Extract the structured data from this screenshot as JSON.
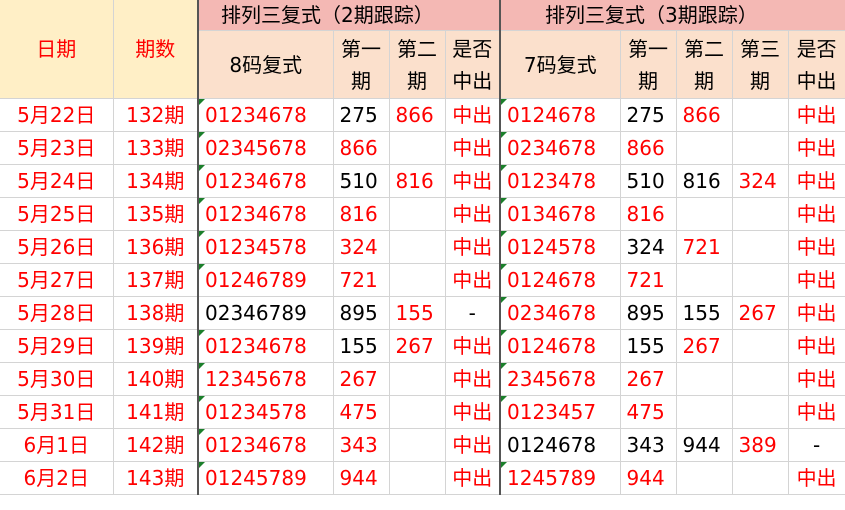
{
  "header": {
    "date": "日期",
    "period": "期数",
    "group2": "排列三复式（2期跟踪）",
    "group3": "排列三复式（3期跟踪）",
    "code8": "8码复式",
    "code7": "7码复式",
    "first_a": "第一",
    "first_b": "期",
    "second_a": "第二",
    "second_b": "期",
    "third_a": "第三",
    "third_b": "期",
    "hit_a": "是否",
    "hit_b": "中出"
  },
  "rows": [
    {
      "date": "5月22日",
      "period": "132期",
      "c8": "01234678",
      "a1": "275",
      "a2": "866",
      "ah": "中出",
      "c7": "0124678",
      "b1": "275",
      "b2": "866",
      "b3": "",
      "bh": "中出"
    },
    {
      "date": "5月23日",
      "period": "133期",
      "c8": "02345678",
      "a1": "866",
      "a2": "",
      "ah": "中出",
      "c7": "0234678",
      "b1": "866",
      "b2": "",
      "b3": "",
      "bh": "中出"
    },
    {
      "date": "5月24日",
      "period": "134期",
      "c8": "01234678",
      "a1": "510",
      "a2": "816",
      "ah": "中出",
      "c7": "0123478",
      "b1": "510",
      "b2": "816",
      "b3": "324",
      "bh": "中出"
    },
    {
      "date": "5月25日",
      "period": "135期",
      "c8": "01234678",
      "a1": "816",
      "a2": "",
      "ah": "中出",
      "c7": "0134678",
      "b1": "816",
      "b2": "",
      "b3": "",
      "bh": "中出"
    },
    {
      "date": "5月26日",
      "period": "136期",
      "c8": "01234578",
      "a1": "324",
      "a2": "",
      "ah": "中出",
      "c7": "0124578",
      "b1": "324",
      "b2": "721",
      "b3": "",
      "bh": "中出"
    },
    {
      "date": "5月27日",
      "period": "137期",
      "c8": "01246789",
      "a1": "721",
      "a2": "",
      "ah": "中出",
      "c7": "0124678",
      "b1": "721",
      "b2": "",
      "b3": "",
      "bh": "中出"
    },
    {
      "date": "5月28日",
      "period": "138期",
      "c8": "02346789",
      "a1": "895",
      "a2": "155",
      "ah": "-",
      "c7": "0234678",
      "b1": "895",
      "b2": "155",
      "b3": "267",
      "bh": "中出"
    },
    {
      "date": "5月29日",
      "period": "139期",
      "c8": "01234678",
      "a1": "155",
      "a2": "267",
      "ah": "中出",
      "c7": "0124678",
      "b1": "155",
      "b2": "267",
      "b3": "",
      "bh": "中出"
    },
    {
      "date": "5月30日",
      "period": "140期",
      "c8": "12345678",
      "a1": "267",
      "a2": "",
      "ah": "中出",
      "c7": "2345678",
      "b1": "267",
      "b2": "",
      "b3": "",
      "bh": "中出"
    },
    {
      "date": "5月31日",
      "period": "141期",
      "c8": "01234578",
      "a1": "475",
      "a2": "",
      "ah": "中出",
      "c7": "0123457",
      "b1": "475",
      "b2": "",
      "b3": "",
      "bh": "中出"
    },
    {
      "date": "6月1日",
      "period": "142期",
      "c8": "01234678",
      "a1": "343",
      "a2": "",
      "ah": "中出",
      "c7": "0124678",
      "b1": "343",
      "b2": "944",
      "b3": "389",
      "bh": "-"
    },
    {
      "date": "6月2日",
      "period": "143期",
      "c8": "01245789",
      "a1": "944",
      "a2": "",
      "ah": "中出",
      "c7": "1245789",
      "b1": "944",
      "b2": "",
      "b3": "",
      "bh": "中出"
    }
  ],
  "colors": {
    "accent_red": "#ff0000",
    "header_pink": "#f4b8b4",
    "header_peach": "#fbe0cc",
    "header_yellow": "#ffefc6",
    "flag_green": "#1b7f2b"
  }
}
